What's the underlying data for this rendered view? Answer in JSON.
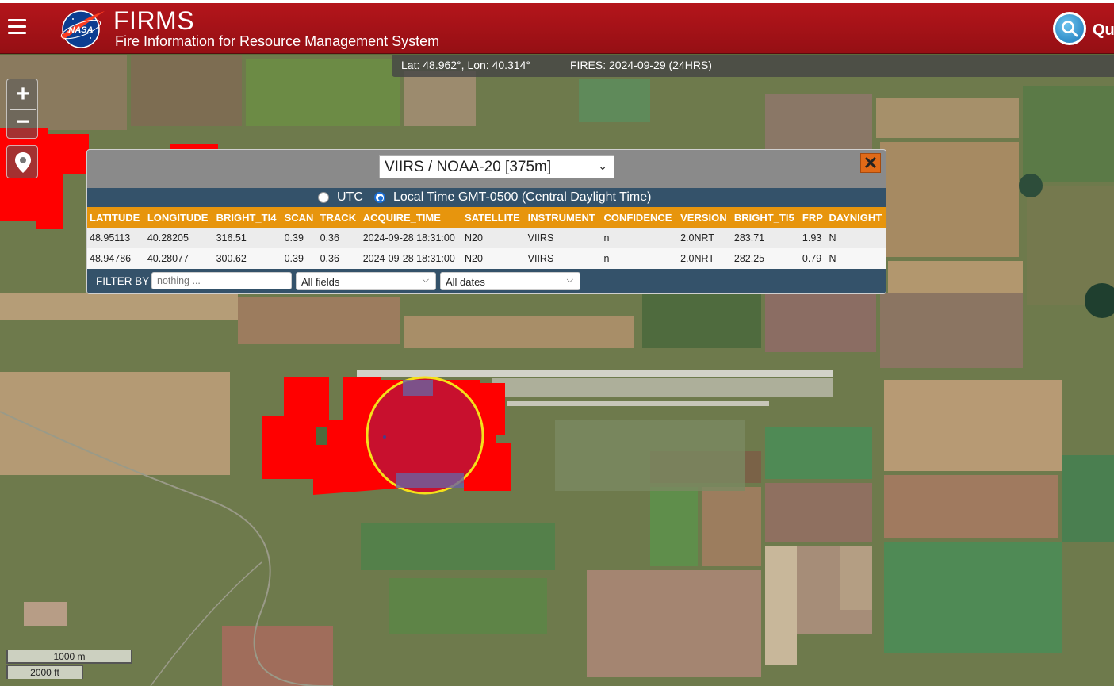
{
  "header": {
    "app_title": "FIRMS",
    "app_subtitle": "Fire Information for Resource Management System",
    "logo_text": "NASA",
    "search_label_partial": "Qu"
  },
  "map": {
    "coords": "Lat: 48.962°, Lon: 40.314°",
    "fires_label": "FIRES: 2024-09-29 (24HRS)",
    "zoom_in": "+",
    "zoom_out": "−",
    "scale_metric": "1000 m",
    "scale_imperial": "2000 ft"
  },
  "popup": {
    "satellite": "VIIRS / NOAA-20 [375m]",
    "close": "✕",
    "tz_utc": "UTC",
    "tz_local": "Local Time GMT-0500 (Central Daylight Time)",
    "columns": [
      "LATITUDE",
      "LONGITUDE",
      "BRIGHT_TI4",
      "SCAN",
      "TRACK",
      "ACQUIRE_TIME",
      "SATELLITE",
      "INSTRUMENT",
      "CONFIDENCE",
      "VERSION",
      "BRIGHT_TI5",
      "FRP",
      "DAYNIGHT"
    ],
    "rows": [
      [
        "48.95113",
        "40.28205",
        "316.51",
        "0.39",
        "0.36",
        "2024-09-28 18:31:00",
        "N20",
        "VIIRS",
        "n",
        "2.0NRT",
        "283.71",
        "1.93",
        "N"
      ],
      [
        "48.94786",
        "40.28077",
        "300.62",
        "0.39",
        "0.36",
        "2024-09-28 18:31:00",
        "N20",
        "VIIRS",
        "n",
        "2.0NRT",
        "282.25",
        "0.79",
        "N"
      ]
    ],
    "filter_label": "FILTER BY",
    "filter_placeholder": "nothing ...",
    "field_select": "All fields",
    "date_select": "All dates"
  },
  "colors": {
    "header_red": "#a8141a",
    "fire_pixel": "#ff0000",
    "highlight_ring": "#f5e01a",
    "table_header": "#e7950d",
    "tz_bar": "#34526a"
  }
}
